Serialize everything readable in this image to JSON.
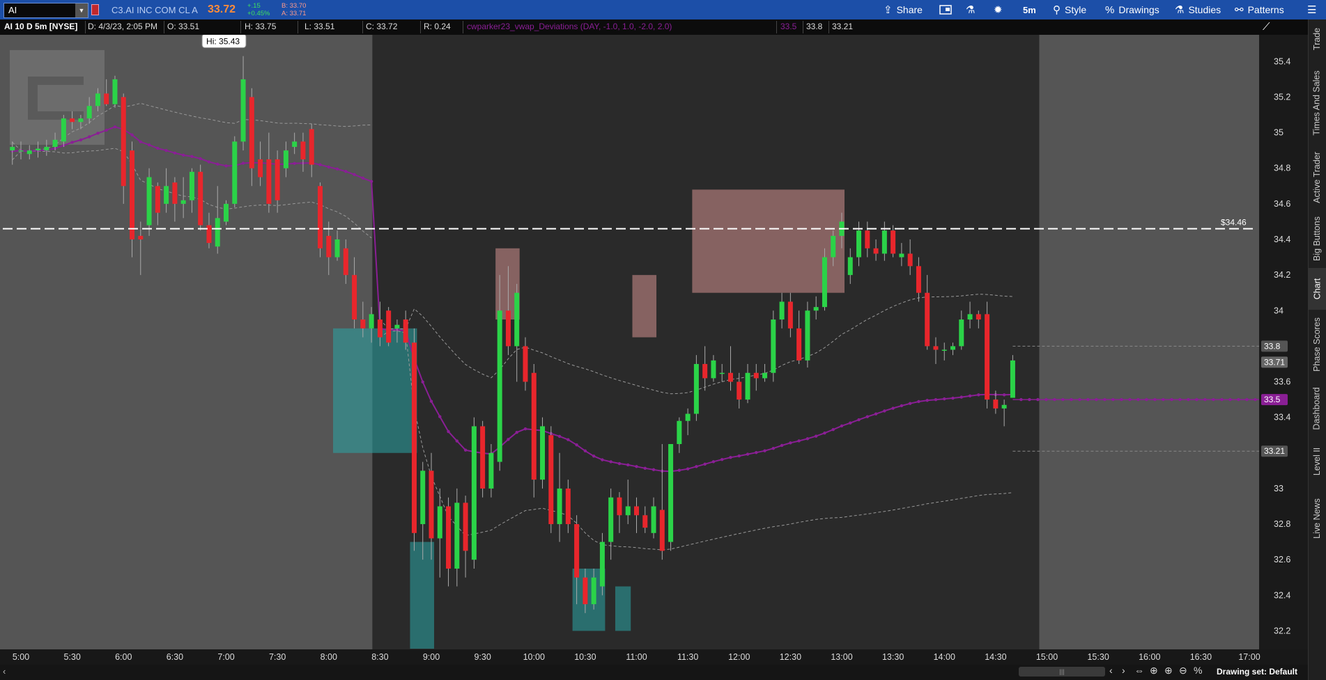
{
  "header": {
    "symbol": "AI",
    "company": "C3.AI INC COM CL A",
    "last_price": "33.72",
    "change": "+.15",
    "change_pct": "+0.45%",
    "bid": "B: 33.70",
    "ask": "A: 33.71"
  },
  "toolbar": {
    "share": "Share",
    "aggregation": "5m",
    "style": "Style",
    "drawings": "Drawings",
    "studies": "Studies",
    "patterns": "Patterns"
  },
  "infobar": {
    "title": "AI 10 D 5m [NYSE]",
    "date": "D: 4/3/23, 2:05 PM",
    "open": "O: 33.51",
    "high": "H: 33.75",
    "low": "L: 33.51",
    "close": "C: 33.72",
    "range": "R: 0.24",
    "study": "cwparker23_vwap_Deviations (DAY, -1.0, 1.0, -2.0, 2.0)",
    "study_values": [
      "33.5",
      "33.8",
      "33.21"
    ]
  },
  "right_tabs": [
    "Trade",
    "Times And Sales",
    "Active Trader",
    "Big Buttons",
    "Chart",
    "Phase Scores",
    "Dashboard",
    "Level II",
    "Live News"
  ],
  "active_tab": "Chart",
  "footer": {
    "drawing_set": "Drawing set: Default"
  },
  "colors": {
    "up": "#2bd348",
    "down": "#e8262c",
    "vwap": "#8a1f95",
    "teal_band": "#2aa5a6",
    "pink_band": "#d18f8e",
    "toolbar": "#1c4fa8"
  },
  "chart_data": {
    "type": "candlestick",
    "title": "AI 10 D 5m [NYSE]",
    "time_labels": [
      "5:00",
      "5:30",
      "6:00",
      "6:30",
      "7:00",
      "7:30",
      "8:00",
      "8:30",
      "9:00",
      "9:30",
      "10:00",
      "10:30",
      "11:00",
      "11:30",
      "12:00",
      "12:30",
      "13:00",
      "13:30",
      "14:00",
      "14:30",
      "15:00",
      "15:30",
      "16:00",
      "16:30",
      "17:00"
    ],
    "price_labels": [
      "35.4",
      "35.2",
      "35",
      "34.8",
      "34.6",
      "34.4",
      "34.2",
      "34",
      "33.6",
      "33.4",
      "33",
      "32.8",
      "32.6",
      "32.4",
      "32.2"
    ],
    "ylim": [
      32.1,
      35.55
    ],
    "price_line": {
      "value": 34.46,
      "label": "$34.46"
    },
    "high_bubble": {
      "value": 35.43,
      "label": "Hi: 35.43"
    },
    "axis_bubbles": [
      {
        "value": 33.8,
        "label": "33.8",
        "kind": "upper"
      },
      {
        "value": 33.71,
        "label": "33.71",
        "kind": "last"
      },
      {
        "value": 33.5,
        "label": "33.5",
        "kind": "vwap"
      },
      {
        "value": 33.21,
        "label": "33.21",
        "kind": "lower"
      }
    ],
    "session": {
      "regular_open": "8:30",
      "regular_close": "15:00"
    },
    "candles": [
      {
        "t": "4:55",
        "o": 34.9,
        "h": 34.95,
        "l": 34.82,
        "c": 34.92
      },
      {
        "t": "5:00",
        "o": 34.9,
        "h": 34.95,
        "l": 34.85,
        "c": 34.9
      },
      {
        "t": "5:05",
        "o": 34.88,
        "h": 34.93,
        "l": 34.85,
        "c": 34.9
      },
      {
        "t": "5:10",
        "o": 34.9,
        "h": 34.95,
        "l": 34.86,
        "c": 34.91
      },
      {
        "t": "5:15",
        "o": 34.9,
        "h": 34.96,
        "l": 34.87,
        "c": 34.92
      },
      {
        "t": "5:20",
        "o": 34.92,
        "h": 35.0,
        "l": 34.9,
        "c": 34.96
      },
      {
        "t": "5:25",
        "o": 34.95,
        "h": 35.1,
        "l": 34.92,
        "c": 35.08
      },
      {
        "t": "5:30",
        "o": 35.08,
        "h": 35.12,
        "l": 35.02,
        "c": 35.06
      },
      {
        "t": "5:35",
        "o": 35.06,
        "h": 35.1,
        "l": 35.02,
        "c": 35.08
      },
      {
        "t": "5:40",
        "o": 35.08,
        "h": 35.2,
        "l": 35.05,
        "c": 35.15
      },
      {
        "t": "5:45",
        "o": 35.15,
        "h": 35.25,
        "l": 35.12,
        "c": 35.22
      },
      {
        "t": "5:50",
        "o": 35.22,
        "h": 35.3,
        "l": 35.15,
        "c": 35.16
      },
      {
        "t": "5:55",
        "o": 35.16,
        "h": 35.32,
        "l": 35.14,
        "c": 35.3
      },
      {
        "t": "6:00",
        "o": 35.2,
        "h": 35.22,
        "l": 34.6,
        "c": 34.7
      },
      {
        "t": "6:05",
        "o": 34.9,
        "h": 34.95,
        "l": 34.3,
        "c": 34.4
      },
      {
        "t": "6:10",
        "o": 34.42,
        "h": 34.5,
        "l": 34.2,
        "c": 34.4
      },
      {
        "t": "6:15",
        "o": 34.48,
        "h": 34.8,
        "l": 34.42,
        "c": 34.75
      },
      {
        "t": "6:20",
        "o": 34.7,
        "h": 34.72,
        "l": 34.48,
        "c": 34.55
      },
      {
        "t": "6:25",
        "o": 34.6,
        "h": 34.8,
        "l": 34.55,
        "c": 34.7
      },
      {
        "t": "6:30",
        "o": 34.72,
        "h": 34.75,
        "l": 34.5,
        "c": 34.6
      },
      {
        "t": "6:35",
        "o": 34.6,
        "h": 34.75,
        "l": 34.52,
        "c": 34.62
      },
      {
        "t": "6:40",
        "o": 34.62,
        "h": 34.8,
        "l": 34.55,
        "c": 34.78
      },
      {
        "t": "6:45",
        "o": 34.78,
        "h": 34.82,
        "l": 34.45,
        "c": 34.48
      },
      {
        "t": "6:50",
        "o": 34.48,
        "h": 34.55,
        "l": 34.35,
        "c": 34.38
      },
      {
        "t": "6:55",
        "o": 34.36,
        "h": 34.7,
        "l": 34.32,
        "c": 34.52
      },
      {
        "t": "7:00",
        "o": 34.5,
        "h": 34.62,
        "l": 34.48,
        "c": 34.6
      },
      {
        "t": "7:05",
        "o": 34.6,
        "h": 34.98,
        "l": 34.58,
        "c": 34.95
      },
      {
        "t": "7:10",
        "o": 34.95,
        "h": 35.43,
        "l": 34.9,
        "c": 35.3
      },
      {
        "t": "7:15",
        "o": 35.2,
        "h": 35.25,
        "l": 34.7,
        "c": 34.8
      },
      {
        "t": "7:20",
        "o": 34.85,
        "h": 34.95,
        "l": 34.7,
        "c": 34.75
      },
      {
        "t": "7:25",
        "o": 34.85,
        "h": 35.0,
        "l": 34.55,
        "c": 34.6
      },
      {
        "t": "7:30",
        "o": 34.85,
        "h": 34.9,
        "l": 34.55,
        "c": 34.62
      },
      {
        "t": "7:35",
        "o": 34.8,
        "h": 34.95,
        "l": 34.75,
        "c": 34.9
      },
      {
        "t": "7:40",
        "o": 34.92,
        "h": 35.0,
        "l": 34.88,
        "c": 34.95
      },
      {
        "t": "7:45",
        "o": 34.95,
        "h": 35.0,
        "l": 34.78,
        "c": 34.85
      },
      {
        "t": "7:50",
        "o": 35.02,
        "h": 35.05,
        "l": 34.75,
        "c": 34.82
      },
      {
        "t": "7:55",
        "o": 34.7,
        "h": 34.72,
        "l": 34.3,
        "c": 34.35
      },
      {
        "t": "8:00",
        "o": 34.42,
        "h": 34.5,
        "l": 34.2,
        "c": 34.3
      },
      {
        "t": "8:05",
        "o": 34.3,
        "h": 34.45,
        "l": 34.28,
        "c": 34.4
      },
      {
        "t": "8:10",
        "o": 34.35,
        "h": 34.4,
        "l": 34.15,
        "c": 34.2
      },
      {
        "t": "8:15",
        "o": 34.2,
        "h": 34.3,
        "l": 33.9,
        "c": 33.95
      },
      {
        "t": "8:20",
        "o": 33.95,
        "h": 34.05,
        "l": 33.85,
        "c": 33.9
      },
      {
        "t": "8:25",
        "o": 33.9,
        "h": 34.02,
        "l": 33.82,
        "c": 33.98
      },
      {
        "t": "8:30",
        "o": 33.95,
        "h": 34.05,
        "l": 33.8,
        "c": 33.85
      },
      {
        "t": "8:35",
        "o": 34.0,
        "h": 34.02,
        "l": 33.8,
        "c": 33.82
      },
      {
        "t": "8:40",
        "o": 33.9,
        "h": 33.95,
        "l": 33.82,
        "c": 33.92
      },
      {
        "t": "8:45",
        "o": 33.95,
        "h": 34.0,
        "l": 33.78,
        "c": 33.82
      },
      {
        "t": "8:50",
        "o": 33.82,
        "h": 33.9,
        "l": 32.65,
        "c": 32.75
      },
      {
        "t": "8:55",
        "o": 32.8,
        "h": 33.15,
        "l": 32.6,
        "c": 33.1
      },
      {
        "t": "9:00",
        "o": 33.1,
        "h": 33.2,
        "l": 32.6,
        "c": 32.72
      },
      {
        "t": "9:05",
        "o": 32.72,
        "h": 33.0,
        "l": 32.5,
        "c": 32.9
      },
      {
        "t": "9:10",
        "o": 32.9,
        "h": 32.95,
        "l": 32.45,
        "c": 32.55
      },
      {
        "t": "9:15",
        "o": 32.55,
        "h": 33.0,
        "l": 32.45,
        "c": 32.92
      },
      {
        "t": "9:20",
        "o": 32.92,
        "h": 32.96,
        "l": 32.5,
        "c": 32.65
      },
      {
        "t": "9:25",
        "o": 32.6,
        "h": 33.4,
        "l": 32.55,
        "c": 33.35
      },
      {
        "t": "9:30",
        "o": 33.35,
        "h": 33.38,
        "l": 32.95,
        "c": 33.0
      },
      {
        "t": "9:35",
        "o": 33.0,
        "h": 33.25,
        "l": 32.95,
        "c": 33.2
      },
      {
        "t": "9:40",
        "o": 33.15,
        "h": 34.2,
        "l": 33.1,
        "c": 34.0
      },
      {
        "t": "9:45",
        "o": 34.0,
        "h": 34.25,
        "l": 33.75,
        "c": 33.8
      },
      {
        "t": "9:50",
        "o": 33.8,
        "h": 34.15,
        "l": 33.6,
        "c": 34.1
      },
      {
        "t": "9:55",
        "o": 33.8,
        "h": 33.85,
        "l": 33.55,
        "c": 33.6
      },
      {
        "t": "10:00",
        "o": 33.65,
        "h": 33.7,
        "l": 32.95,
        "c": 33.05
      },
      {
        "t": "10:05",
        "o": 33.05,
        "h": 33.4,
        "l": 33.0,
        "c": 33.35
      },
      {
        "t": "10:10",
        "o": 33.3,
        "h": 33.35,
        "l": 32.75,
        "c": 32.8
      },
      {
        "t": "10:15",
        "o": 32.8,
        "h": 33.2,
        "l": 32.7,
        "c": 33.0
      },
      {
        "t": "10:20",
        "o": 33.0,
        "h": 33.05,
        "l": 32.75,
        "c": 32.8
      },
      {
        "t": "10:25",
        "o": 32.8,
        "h": 32.85,
        "l": 32.35,
        "c": 32.5
      },
      {
        "t": "10:30",
        "o": 32.5,
        "h": 32.55,
        "l": 32.3,
        "c": 32.35
      },
      {
        "t": "10:35",
        "o": 32.35,
        "h": 32.55,
        "l": 32.32,
        "c": 32.5
      },
      {
        "t": "10:40",
        "o": 32.45,
        "h": 32.75,
        "l": 32.4,
        "c": 32.7
      },
      {
        "t": "10:45",
        "o": 32.7,
        "h": 33.0,
        "l": 32.6,
        "c": 32.95
      },
      {
        "t": "10:50",
        "o": 32.95,
        "h": 32.98,
        "l": 32.75,
        "c": 32.85
      },
      {
        "t": "10:55",
        "o": 32.85,
        "h": 33.05,
        "l": 32.8,
        "c": 32.9
      },
      {
        "t": "11:00",
        "o": 32.9,
        "h": 32.95,
        "l": 32.75,
        "c": 32.85
      },
      {
        "t": "11:05",
        "o": 32.85,
        "h": 32.9,
        "l": 32.75,
        "c": 32.78
      },
      {
        "t": "11:10",
        "o": 32.75,
        "h": 32.95,
        "l": 32.72,
        "c": 32.9
      },
      {
        "t": "11:15",
        "o": 32.88,
        "h": 33.25,
        "l": 32.6,
        "c": 32.65
      },
      {
        "t": "11:20",
        "o": 32.7,
        "h": 33.2,
        "l": 32.65,
        "c": 33.25
      },
      {
        "t": "11:25",
        "o": 33.25,
        "h": 33.4,
        "l": 33.2,
        "c": 33.38
      },
      {
        "t": "11:30",
        "o": 33.38,
        "h": 33.45,
        "l": 33.3,
        "c": 33.42
      },
      {
        "t": "11:35",
        "o": 33.42,
        "h": 33.75,
        "l": 33.38,
        "c": 33.7
      },
      {
        "t": "11:40",
        "o": 33.7,
        "h": 33.8,
        "l": 33.55,
        "c": 33.62
      },
      {
        "t": "11:45",
        "o": 33.62,
        "h": 33.75,
        "l": 33.6,
        "c": 33.72
      },
      {
        "t": "11:50",
        "o": 33.65,
        "h": 33.7,
        "l": 33.6,
        "c": 33.65
      },
      {
        "t": "11:55",
        "o": 33.65,
        "h": 33.8,
        "l": 33.55,
        "c": 33.6
      },
      {
        "t": "12:00",
        "o": 33.6,
        "h": 33.65,
        "l": 33.45,
        "c": 33.5
      },
      {
        "t": "12:05",
        "o": 33.5,
        "h": 33.7,
        "l": 33.48,
        "c": 33.65
      },
      {
        "t": "12:10",
        "o": 33.65,
        "h": 33.7,
        "l": 33.55,
        "c": 33.62
      },
      {
        "t": "12:15",
        "o": 33.62,
        "h": 33.7,
        "l": 33.6,
        "c": 33.65
      },
      {
        "t": "12:20",
        "o": 33.65,
        "h": 34.0,
        "l": 33.6,
        "c": 33.95
      },
      {
        "t": "12:25",
        "o": 33.95,
        "h": 34.1,
        "l": 33.9,
        "c": 34.05
      },
      {
        "t": "12:30",
        "o": 34.05,
        "h": 34.1,
        "l": 33.85,
        "c": 33.9
      },
      {
        "t": "12:35",
        "o": 33.9,
        "h": 34.0,
        "l": 33.7,
        "c": 33.72
      },
      {
        "t": "12:40",
        "o": 33.72,
        "h": 34.05,
        "l": 33.68,
        "c": 34.0
      },
      {
        "t": "12:45",
        "o": 34.0,
        "h": 34.08,
        "l": 33.95,
        "c": 34.02
      },
      {
        "t": "12:50",
        "o": 34.02,
        "h": 34.35,
        "l": 34.0,
        "c": 34.3
      },
      {
        "t": "12:55",
        "o": 34.3,
        "h": 34.45,
        "l": 34.25,
        "c": 34.42
      },
      {
        "t": "13:00",
        "o": 34.42,
        "h": 34.55,
        "l": 34.35,
        "c": 34.5
      },
      {
        "t": "13:05",
        "o": 34.2,
        "h": 34.35,
        "l": 34.15,
        "c": 34.3
      },
      {
        "t": "13:10",
        "o": 34.3,
        "h": 34.5,
        "l": 34.25,
        "c": 34.45
      },
      {
        "t": "13:15",
        "o": 34.45,
        "h": 34.5,
        "l": 34.3,
        "c": 34.35
      },
      {
        "t": "13:20",
        "o": 34.35,
        "h": 34.4,
        "l": 34.28,
        "c": 34.32
      },
      {
        "t": "13:25",
        "o": 34.32,
        "h": 34.5,
        "l": 34.28,
        "c": 34.45
      },
      {
        "t": "13:30",
        "o": 34.45,
        "h": 34.48,
        "l": 34.3,
        "c": 34.32
      },
      {
        "t": "13:35",
        "o": 34.3,
        "h": 34.38,
        "l": 34.25,
        "c": 34.32
      },
      {
        "t": "13:40",
        "o": 34.32,
        "h": 34.4,
        "l": 34.2,
        "c": 34.25
      },
      {
        "t": "13:45",
        "o": 34.25,
        "h": 34.3,
        "l": 34.05,
        "c": 34.1
      },
      {
        "t": "13:50",
        "o": 34.1,
        "h": 34.2,
        "l": 33.78,
        "c": 33.8
      },
      {
        "t": "13:55",
        "o": 33.8,
        "h": 33.85,
        "l": 33.7,
        "c": 33.78
      },
      {
        "t": "14:00",
        "o": 33.78,
        "h": 33.82,
        "l": 33.72,
        "c": 33.78
      },
      {
        "t": "14:05",
        "o": 33.78,
        "h": 33.82,
        "l": 33.75,
        "c": 33.8
      },
      {
        "t": "14:10",
        "o": 33.8,
        "h": 34.0,
        "l": 33.78,
        "c": 33.95
      },
      {
        "t": "14:15",
        "o": 33.95,
        "h": 34.05,
        "l": 33.9,
        "c": 33.98
      },
      {
        "t": "14:20",
        "o": 33.98,
        "h": 34.0,
        "l": 33.9,
        "c": 33.95
      },
      {
        "t": "14:25",
        "o": 33.98,
        "h": 34.05,
        "l": 33.45,
        "c": 33.5
      },
      {
        "t": "14:30",
        "o": 33.5,
        "h": 33.55,
        "l": 33.42,
        "c": 33.45
      },
      {
        "t": "14:35",
        "o": 33.45,
        "h": 33.5,
        "l": 33.35,
        "c": 33.47
      },
      {
        "t": "14:40",
        "o": 33.51,
        "h": 33.75,
        "l": 33.51,
        "c": 33.72
      }
    ]
  }
}
